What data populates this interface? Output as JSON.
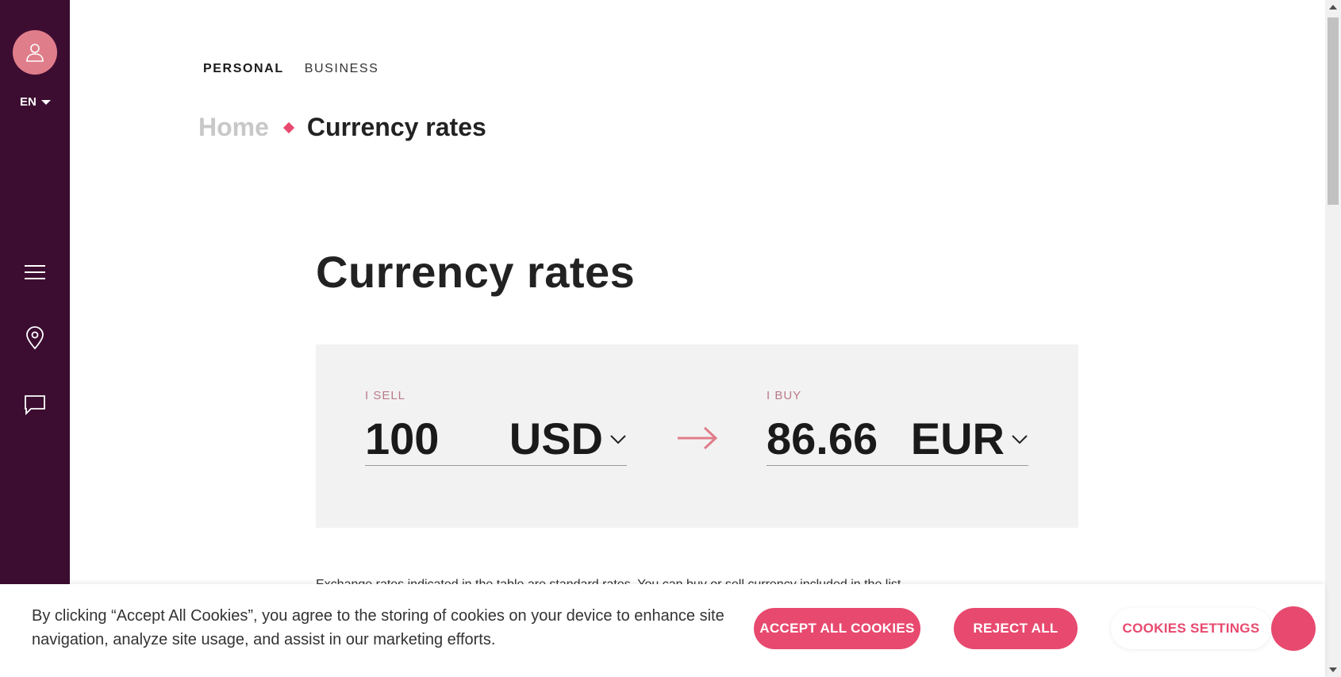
{
  "sidebar": {
    "language": "EN",
    "icons": [
      "user-icon",
      "menu-icon",
      "location-pin-icon",
      "chat-icon"
    ]
  },
  "topnav": {
    "personal": "PERSONAL",
    "business": "BUSINESS"
  },
  "breadcrumb": {
    "home": "Home",
    "current": "Currency rates"
  },
  "page": {
    "title": "Currency rates",
    "intro_text": "Exchange rates indicated in the table are standard rates. You can buy or sell currency included in the list"
  },
  "converter": {
    "sell_label": "I SELL",
    "sell_amount": "100",
    "sell_currency": "USD",
    "buy_label": "I BUY",
    "buy_amount": "86.66",
    "buy_currency": "EUR"
  },
  "cookies": {
    "text": "By clicking “Accept All Cookies”, you agree to the storing of cookies on your device to enhance site navigation, analyze site usage, and assist in our marketing efforts.",
    "accept_label": "ACCEPT ALL COOKIES",
    "reject_label": "REJECT ALL",
    "settings_label": "COOKIES SETTINGS"
  },
  "colors": {
    "sidebar": "#3c0d31",
    "accent": "#e8496f",
    "avatar": "#e07d8a",
    "converter_bg": "#f2f2f2"
  }
}
